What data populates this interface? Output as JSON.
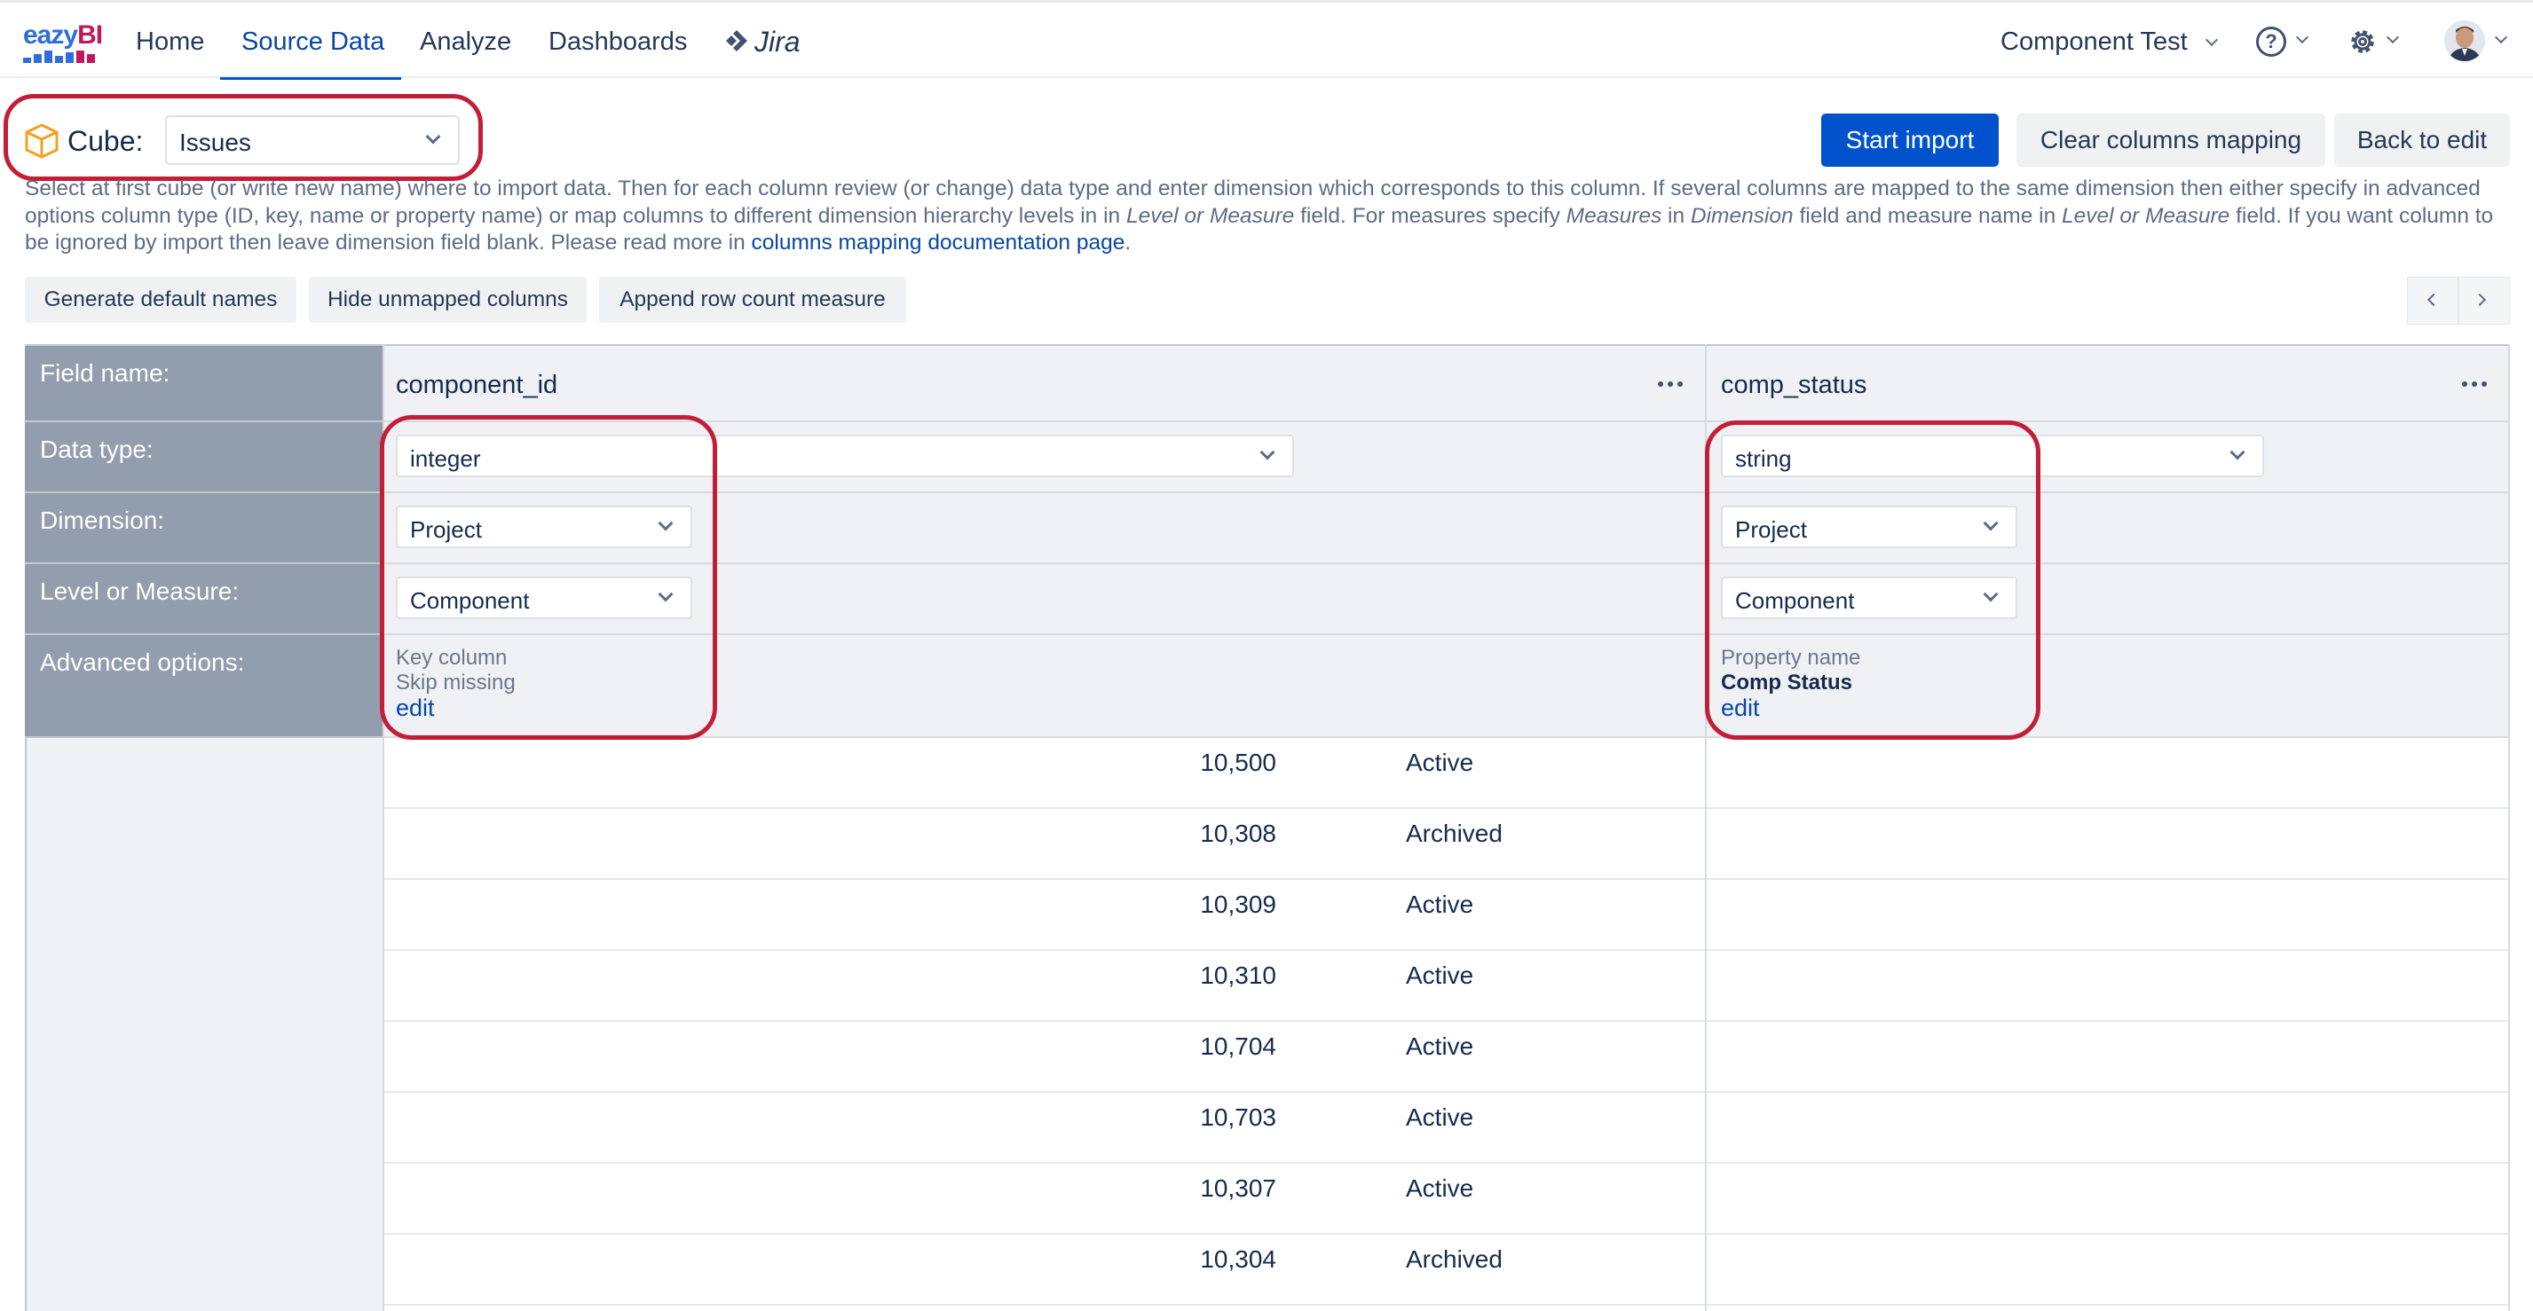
{
  "nav": {
    "logo_left": "ea",
    "logo_mid": "zy",
    "logo_right": "BI",
    "home": "Home",
    "source_data": "Source Data",
    "analyze": "Analyze",
    "dashboards": "Dashboards",
    "jira": "Jira",
    "account": "Component Test"
  },
  "cube": {
    "label": "Cube:",
    "value": "Issues"
  },
  "actions": {
    "start_import": "Start import",
    "clear_mapping": "Clear columns mapping",
    "back_to_edit": "Back to edit"
  },
  "description": {
    "part1": "Select at first cube (or write new name) where to import data. Then for each column review (or change) data type and enter dimension which corresponds to this column. If several columns are mapped to the same dimension then either specify in advanced options column type (ID, key, name or property name) or map columns to different dimension hierarchy levels in in ",
    "em1": "Level or Measure",
    "part2": " field. For measures specify ",
    "em2": "Measures",
    "part3": " in ",
    "em3": "Dimension",
    "part4": " field and measure name in ",
    "em4": "Level or Measure",
    "part5": " field. If you want column to be ignored by import then leave dimension field blank. Please read more in ",
    "link": "columns mapping documentation page",
    "part6": "."
  },
  "tools": {
    "generate": "Generate default names",
    "hide": "Hide unmapped columns",
    "append": "Append row count measure"
  },
  "labels": {
    "field_name": "Field name:",
    "data_type": "Data type:",
    "dimension": "Dimension:",
    "level": "Level or Measure:",
    "advanced": "Advanced options:"
  },
  "columns": [
    {
      "field": "component_id",
      "data_type": "integer",
      "dimension": "Project",
      "level": "Component",
      "adv_line1": "Key column",
      "adv_line2": "Skip missing",
      "edit": "edit"
    },
    {
      "field": "comp_status",
      "data_type": "string",
      "dimension": "Project",
      "level": "Component",
      "adv_line1": "Property name",
      "adv_line2": "Comp Status",
      "edit": "edit"
    }
  ],
  "rows": [
    {
      "id": "10,500",
      "status": "Active"
    },
    {
      "id": "10,308",
      "status": "Archived"
    },
    {
      "id": "10,309",
      "status": "Active"
    },
    {
      "id": "10,310",
      "status": "Active"
    },
    {
      "id": "10,704",
      "status": "Active"
    },
    {
      "id": "10,703",
      "status": "Active"
    },
    {
      "id": "10,307",
      "status": "Active"
    },
    {
      "id": "10,304",
      "status": "Archived"
    }
  ],
  "colors": {
    "primary": "#0052cc",
    "highlight": "#c41d38",
    "label_bg": "#929ead",
    "cube_icon": "#f59f23"
  }
}
